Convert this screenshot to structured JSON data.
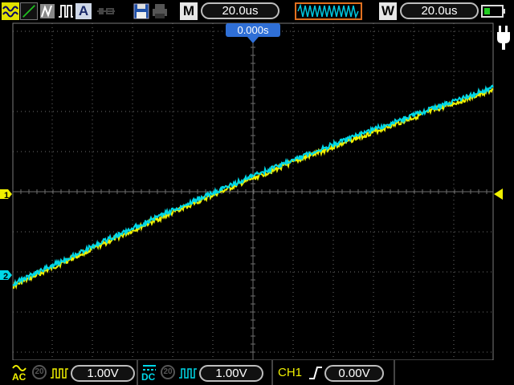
{
  "toolbar": {
    "mode_label": "M",
    "timebase_value": "20.0us",
    "window_label": "W",
    "window_timebase_value": "20.0us"
  },
  "trigger": {
    "position_label": "0.000s"
  },
  "channels": {
    "ch1": {
      "marker": "1",
      "color": "#f0f000",
      "coupling": "AC",
      "bw": "20",
      "scale": "1.00V"
    },
    "ch2": {
      "marker": "2",
      "color": "#00d8e8",
      "coupling": "DC",
      "bw": "20",
      "scale": "1.00V"
    }
  },
  "trigger_panel": {
    "source": "CH1",
    "level": "0.00V"
  },
  "colors": {
    "grid": "#6e6e6e",
    "ch1": "#f0f000",
    "ch2": "#00d8e8",
    "accent": "#2f6fd6",
    "battery": "#22cc22"
  },
  "icons": [
    "waveform-icon",
    "cursor-icon",
    "persist-icon",
    "pulse-icon",
    "auto-icon",
    "usb-icon",
    "save-icon",
    "print-icon",
    "power-plug-icon",
    "battery-icon"
  ]
}
